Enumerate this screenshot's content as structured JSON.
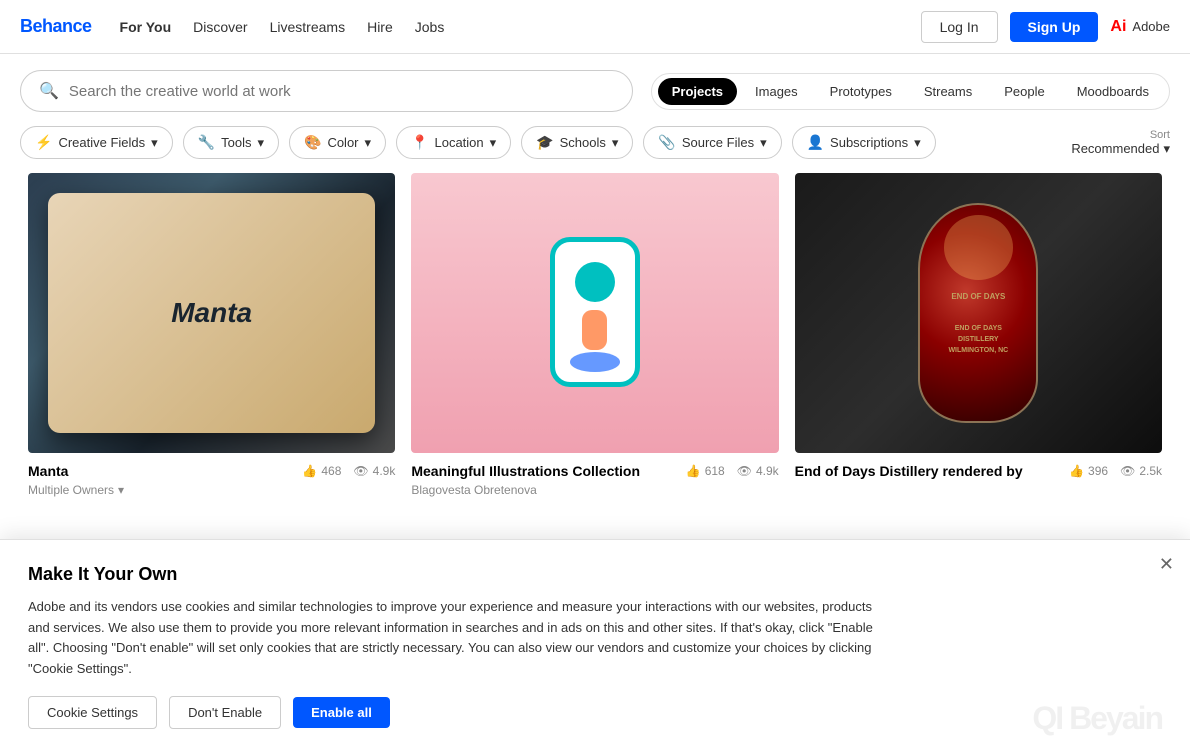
{
  "brand": {
    "logo_text": "Behance",
    "adobe_label": "Adobe"
  },
  "header": {
    "nav": [
      {
        "label": "For You",
        "active": true
      },
      {
        "label": "Discover",
        "active": false
      },
      {
        "label": "Livestreams",
        "active": false
      },
      {
        "label": "Hire",
        "active": false
      },
      {
        "label": "Jobs",
        "active": false
      }
    ],
    "login_label": "Log In",
    "signup_label": "Sign Up"
  },
  "search": {
    "placeholder": "Search the creative world at work",
    "tabs": [
      {
        "label": "Projects",
        "active": true
      },
      {
        "label": "Images",
        "active": false
      },
      {
        "label": "Prototypes",
        "active": false
      },
      {
        "label": "Streams",
        "active": false
      },
      {
        "label": "People",
        "active": false
      },
      {
        "label": "Moodboards",
        "active": false
      }
    ]
  },
  "filters": [
    {
      "label": "Creative Fields",
      "icon": "🎨"
    },
    {
      "label": "Tools",
      "icon": "🔧"
    },
    {
      "label": "Color",
      "icon": "🎨"
    },
    {
      "label": "Location",
      "icon": "📍"
    },
    {
      "label": "Schools",
      "icon": "🎓"
    },
    {
      "label": "Source Files",
      "icon": "📎"
    },
    {
      "label": "Subscriptions",
      "icon": "👤"
    }
  ],
  "sort": {
    "label": "Sort",
    "value": "Recommended"
  },
  "projects": [
    {
      "title": "Manta",
      "author": "Multiple Owners",
      "has_dropdown": true,
      "likes": "468",
      "views": "4.9k",
      "type": "manta"
    },
    {
      "title": "Meaningful Illustrations Collection",
      "author": "Blagovesta Obretenova",
      "has_dropdown": false,
      "likes": "618",
      "views": "4.9k",
      "type": "illustration"
    },
    {
      "title": "End of Days Distillery rendered by",
      "author": "",
      "has_dropdown": false,
      "likes": "396",
      "views": "2.5k",
      "type": "distillery"
    }
  ],
  "cookie": {
    "title": "Make It Your Own",
    "text": "Adobe and its vendors use cookies and similar technologies to improve your experience and measure your interactions with our websites, products and services. We also use them to provide you more relevant information in searches and in ads on this and other sites. If that's okay, click \"Enable all\". Choosing \"Don't enable\" will set only cookies that are strictly necessary. You can also view our vendors and customize your choices by clicking \"Cookie Settings\".",
    "settings_label": "Cookie Settings",
    "dont_enable_label": "Don't Enable",
    "enable_all_label": "Enable all",
    "watermark": "QI Beyain"
  }
}
